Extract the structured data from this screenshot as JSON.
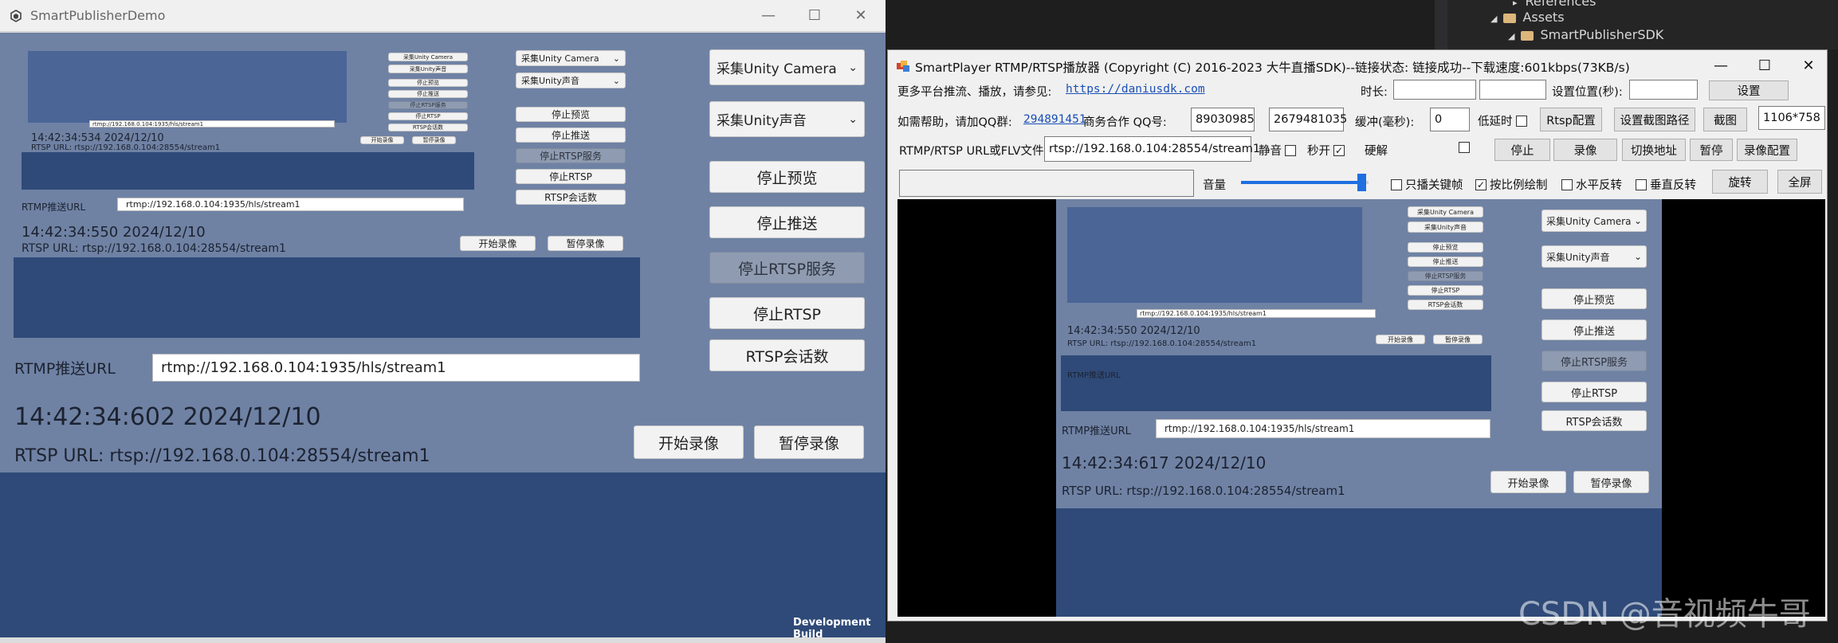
{
  "unity_window": {
    "title": "SmartPublisherDemo",
    "min": "—",
    "max": "☐",
    "close": "✕",
    "dev_build": "Development Build"
  },
  "unity_ui": {
    "camera_dropdown": "采集Unity Camera",
    "audio_dropdown": "采集Unity声音",
    "stop_preview": "停止预览",
    "stop_push": "停止推送",
    "stop_rtsp_service": "停止RTSP服务",
    "stop_rtsp": "停止RTSP",
    "rtsp_sessions": "RTSP会话数",
    "start_record": "开始录像",
    "pause_record": "暂停录像",
    "rtmp_label": "RTMP推送URL",
    "rtmp_url": "rtmp://192.168.0.104:1935/hls/stream1",
    "rtsp_url_text": "RTSP URL: rtsp://192.168.0.104:28554/stream1",
    "timestamp_main": "14:42:34:602 2024/12/10",
    "timestamp_nested1": "14:42:34:550 2024/12/10",
    "timestamp_nested2": "14:42:34:534 2024/12/10",
    "timestamp_player": "14:42:34:617 2024/12/10"
  },
  "player_window": {
    "title": "SmartPlayer RTMP/RTSP播放器 (Copyright (C) 2016-2023 大牛直播SDK)--链接状态: 链接成功--下载速度:601kbps(73KB/s)",
    "min": "—",
    "max": "☐",
    "close": "✕",
    "more_platforms": "更多平台推流、播放，请参见:",
    "link_site": "https://daniusdk.com",
    "duration_label": "时长:",
    "set_pos_label": "设置位置(秒):",
    "set_button": "设置",
    "help_label": "如需帮助，请加QQ群:",
    "qq_group": "294891451",
    "biz_label": "商务合作 QQ号:",
    "biz_qq1": "89030985",
    "biz_qq2": "2679481035",
    "buffer_label": "缓冲(毫秒):",
    "buffer_value": "0",
    "low_latency": "低延时",
    "rtsp_config": "Rtsp配置",
    "set_snapshot_path": "设置截图路径",
    "snapshot": "截图",
    "resolution": "1106*758",
    "url_label": "RTMP/RTSP URL或FLV文件",
    "url_value": "rtsp://192.168.0.104:28554/stream1",
    "mute": "静音",
    "instant_open": "秒开",
    "hw_decode": "硬解",
    "stop": "停止",
    "record": "录像",
    "switch_url": "切换地址",
    "pause": "暂停",
    "record_config": "录像配置",
    "volume_label": "音量",
    "volume_level": 0.95,
    "keyframe_only": "只播关键帧",
    "scale_draw": "按比例绘制",
    "h_flip": "水平反转",
    "v_flip": "垂直反转",
    "rotate": "旋转",
    "fullscreen": "全屏"
  },
  "vs_panel": {
    "references": "References",
    "assets": "Assets",
    "sdk": "SmartPublisherSDK"
  },
  "watermark": "CSDN @音视频牛哥",
  "colors": {
    "unity_panel": "#6f82a4",
    "unity_bg": "#2f4a78",
    "disabled_btn": "#8f9bb0",
    "link": "#1a4fb5",
    "volume_fill": "#1e6fe0"
  }
}
